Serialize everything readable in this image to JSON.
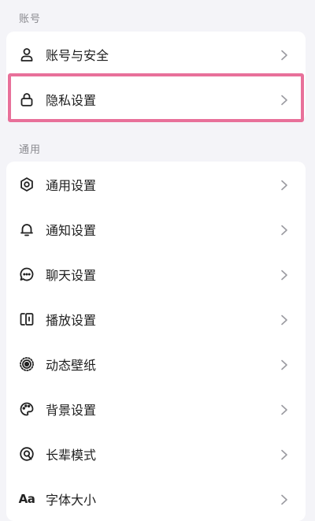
{
  "account_section": {
    "title": "账号",
    "items": [
      {
        "label": "账号与安全",
        "icon": "user-icon"
      },
      {
        "label": "隐私设置",
        "icon": "lock-icon"
      }
    ]
  },
  "general_section": {
    "title": "通用",
    "items": [
      {
        "label": "通用设置",
        "icon": "gear-icon"
      },
      {
        "label": "通知设置",
        "icon": "bell-icon"
      },
      {
        "label": "聊天设置",
        "icon": "chat-bubble-icon"
      },
      {
        "label": "播放设置",
        "icon": "play-device-icon"
      },
      {
        "label": "动态壁纸",
        "icon": "live-wallpaper-icon"
      },
      {
        "label": "背景设置",
        "icon": "palette-icon"
      },
      {
        "label": "长辈模式",
        "icon": "elder-mode-icon"
      },
      {
        "label": "字体大小",
        "icon": "font-size-icon",
        "icon_text": "Aa"
      }
    ]
  },
  "highlight_color": "#e8709a"
}
